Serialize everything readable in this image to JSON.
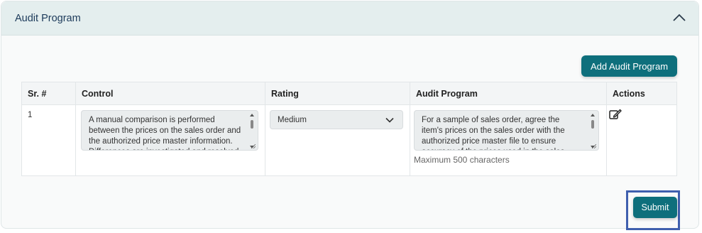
{
  "panel": {
    "title": "Audit Program"
  },
  "add_button": {
    "label": "Add Audit Program"
  },
  "table": {
    "headers": [
      "Sr. #",
      "Control",
      "Rating",
      "Audit Program",
      "Actions"
    ],
    "rows": [
      {
        "sr": "1",
        "control": "A manual comparison is performed between the prices on the sales order and the authorized price master information. Differences are investigated and resolved.",
        "rating": "Medium",
        "audit_program": "For a sample of sales order, agree the item's prices on the sales order with the authorized price master file to ensure accuracy of the prices used in the sales order.",
        "audit_program_hint": "Maximum 500 characters"
      }
    ]
  },
  "submit_button": {
    "label": "Submit"
  },
  "colors": {
    "accent": "#0e6f7c",
    "header_bg": "#e4eeee",
    "highlight_frame": "#3f5fae"
  },
  "icons": [
    "chevron-up-icon",
    "chevron-down-icon",
    "edit-icon"
  ]
}
